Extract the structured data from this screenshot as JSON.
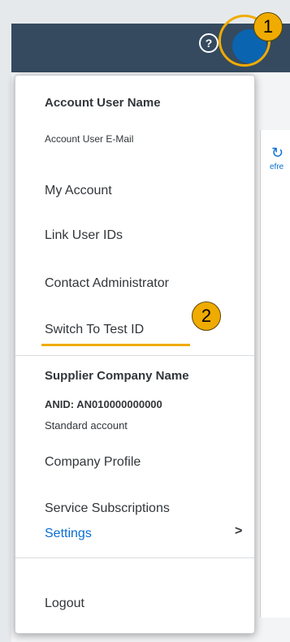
{
  "header": {
    "help_icon": "question-circle-icon",
    "avatar_icon": "user-avatar"
  },
  "callouts": {
    "one": "1",
    "two": "2"
  },
  "background": {
    "refresh_label": "efre"
  },
  "user": {
    "name": "Account User Name",
    "email": "Account User E-Mail",
    "items": [
      "My Account",
      "Link User IDs",
      "Contact Administrator",
      "Switch To Test ID"
    ]
  },
  "company": {
    "name": "Supplier Company Name",
    "anid": "ANID: AN010000000000",
    "account_type": "Standard account",
    "items": [
      "Company Profile",
      "Service Subscriptions"
    ],
    "settings": "Settings"
  },
  "logout": "Logout",
  "colors": {
    "header_bg": "#354a5f",
    "highlight": "#f0ab00",
    "link": "#0a6ed1",
    "avatar": "#0a64b0"
  }
}
